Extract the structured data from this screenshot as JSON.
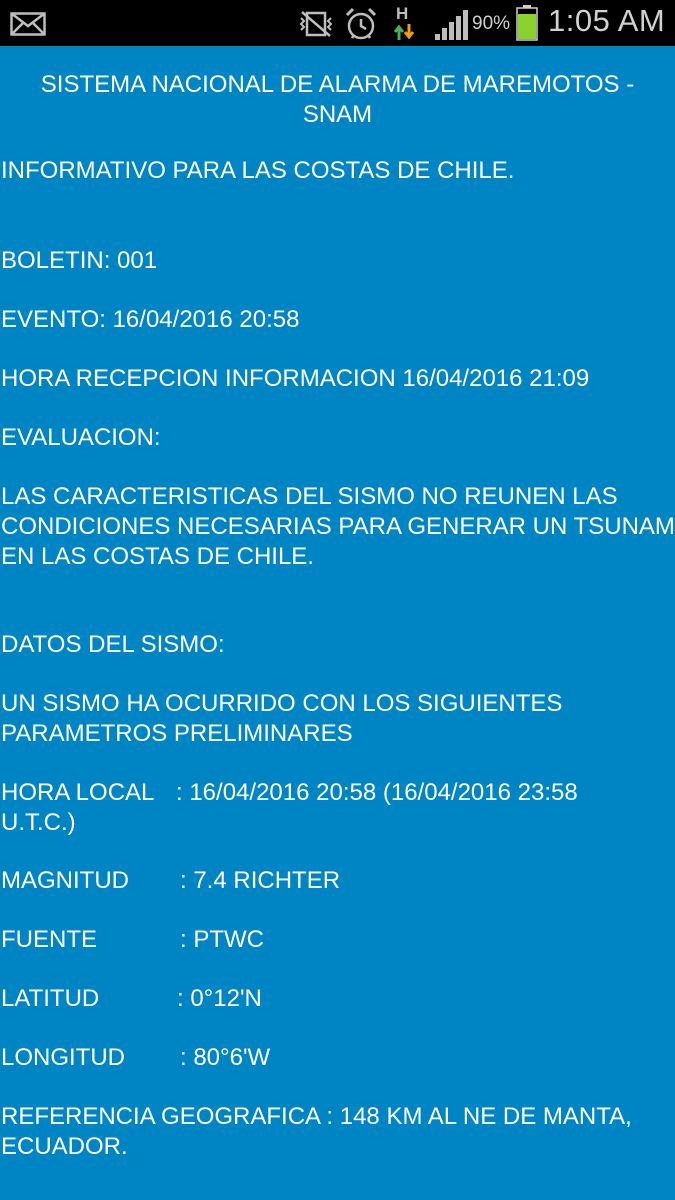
{
  "status_bar": {
    "battery_percent": "90%",
    "time": "1:05 AM",
    "network_type": "H",
    "icons": [
      "email-icon",
      "vibrate-off-icon",
      "alarm-icon",
      "data-arrows-icon",
      "signal-icon",
      "battery-icon"
    ],
    "battery_level": 0.9,
    "battery_color": "#8bd22b"
  },
  "colors": {
    "background": "#0085c4",
    "text": "#ffffff",
    "status_bar": "#000000"
  },
  "bulletin": {
    "title_line1": "SISTEMA NACIONAL DE ALARMA DE MAREMOTOS -",
    "title_line2": "SNAM",
    "informativo": "INFORMATIVO PARA LAS COSTAS DE CHILE.",
    "boletin": "BOLETIN: 001",
    "evento": "EVENTO: 16/04/2016 20:58",
    "hora_recepcion": "HORA RECEPCION INFORMACION 16/04/2016 21:09",
    "evaluacion_header": "EVALUACION:",
    "evaluacion_line1": "LAS CARACTERISTICAS DEL SISMO NO REUNEN LAS",
    "evaluacion_line2": "CONDICIONES NECESARIAS PARA GENERAR UN TSUNAMI",
    "evaluacion_line3": "EN LAS COSTAS DE CHILE.",
    "datos_header": "DATOS DEL SISMO:",
    "datos_intro_line1": "UN SISMO HA OCURRIDO CON LOS SIGUIENTES",
    "datos_intro_line2": "PARAMETROS PRELIMINARES",
    "hora_local_label": "HORA LOCAL",
    "hora_local_value": ": 16/04/2016 20:58 (16/04/2016 23:58",
    "hora_local_value_cont": "U.T.C.)",
    "magnitud_label": "MAGNITUD",
    "magnitud_value": ": 7.4 RICHTER",
    "fuente_label": "FUENTE",
    "fuente_value": ": PTWC",
    "latitud_label": "LATITUD",
    "latitud_value": ": 0°12'N",
    "longitud_label": "LONGITUD",
    "longitud_value": ": 80°6'W",
    "referencia_line1": "REFERENCIA GEOGRAFICA : 148 KM AL NE DE MANTA,",
    "referencia_line2": "ECUADOR."
  }
}
